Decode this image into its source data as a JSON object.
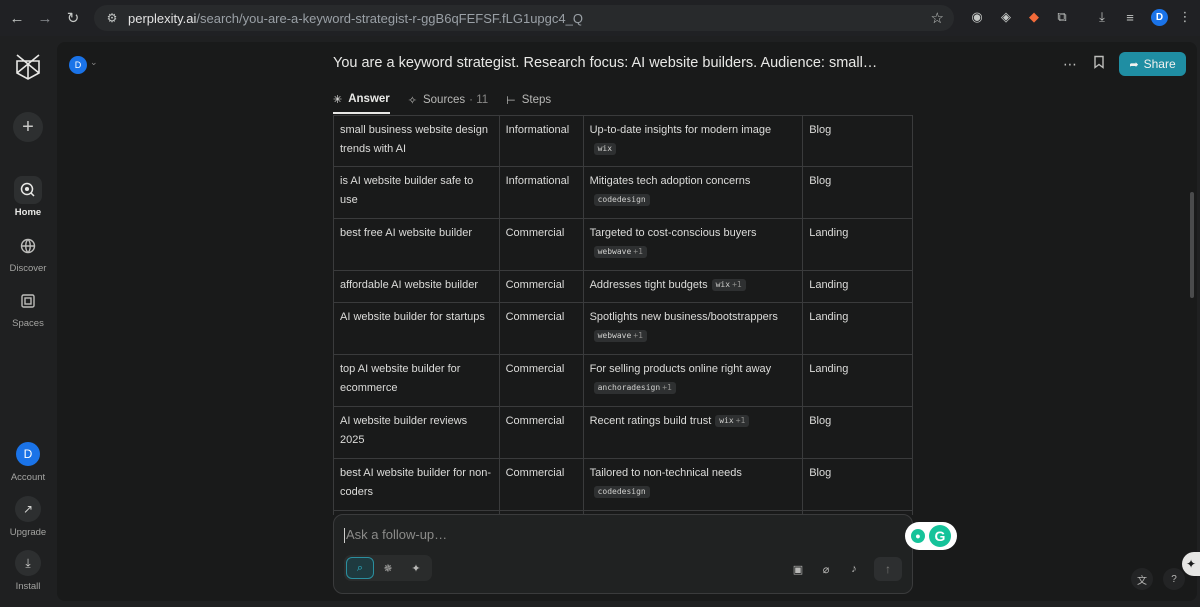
{
  "browser": {
    "url_host": "perplexity.ai",
    "url_path": "/search/you-are-a-keyword-strategist-r-ggB6qFEFSF.fLG1upgc4_Q",
    "profile_initial": "D"
  },
  "sidebar": {
    "items": [
      {
        "label": "Home",
        "icon": "home-icon"
      },
      {
        "label": "Discover",
        "icon": "globe-icon"
      },
      {
        "label": "Spaces",
        "icon": "spaces-icon"
      }
    ],
    "account_initial": "D",
    "account_label": "Account",
    "upgrade_label": "Upgrade",
    "install_label": "Install"
  },
  "header": {
    "user_initial": "D",
    "title": "You are a keyword strategist. Research focus: AI website builders. Audience: small…",
    "tabs": [
      {
        "label": "Answer"
      },
      {
        "label": "Sources",
        "count": "· 11"
      },
      {
        "label": "Steps"
      }
    ],
    "share_label": "Share"
  },
  "table": {
    "rows": [
      {
        "keyword": "small business website design trends with AI",
        "intent": "Informational",
        "note": "Up-to-date insights for modern image",
        "cite": "wix",
        "cite_more": "",
        "type": "Blog"
      },
      {
        "keyword": "is AI website builder safe to use",
        "intent": "Informational",
        "note": "Mitigates tech adoption concerns",
        "cite": "codedesign",
        "cite_more": "",
        "type": "Blog"
      },
      {
        "keyword": "best free AI website builder",
        "intent": "Commercial",
        "note": "Targeted to cost-conscious buyers",
        "cite": "webwave",
        "cite_more": "+1",
        "type": "Landing"
      },
      {
        "keyword": "affordable AI website builder",
        "intent": "Commercial",
        "note": "Addresses tight budgets",
        "cite": "wix",
        "cite_more": "+1",
        "type": "Landing"
      },
      {
        "keyword": "AI website builder for startups",
        "intent": "Commercial",
        "note": "Spotlights new business/bootstrappers",
        "cite": "webwave",
        "cite_more": "+1",
        "type": "Landing"
      },
      {
        "keyword": "top AI website builder for ecommerce",
        "intent": "Commercial",
        "note": "For selling products online right away",
        "cite": "anchoradesign",
        "cite_more": "+1",
        "type": "Landing"
      },
      {
        "keyword": "AI website builder reviews 2025",
        "intent": "Commercial",
        "note": "Recent ratings build trust",
        "cite": "wix",
        "cite_more": "+1",
        "type": "Blog"
      },
      {
        "keyword": "best AI website builder for non-coders",
        "intent": "Commercial",
        "note": "Tailored to non-technical needs",
        "cite": "codedesign",
        "cite_more": "",
        "type": "Blog"
      },
      {
        "keyword": "",
        "intent": "",
        "note": "",
        "cite": "",
        "cite_more": "",
        "type": ""
      }
    ]
  },
  "composer": {
    "placeholder": "Ask a follow-up…"
  },
  "colors": {
    "accent": "#1f8ea3",
    "background": "#191a1a",
    "sidebar": "#1f2021"
  }
}
